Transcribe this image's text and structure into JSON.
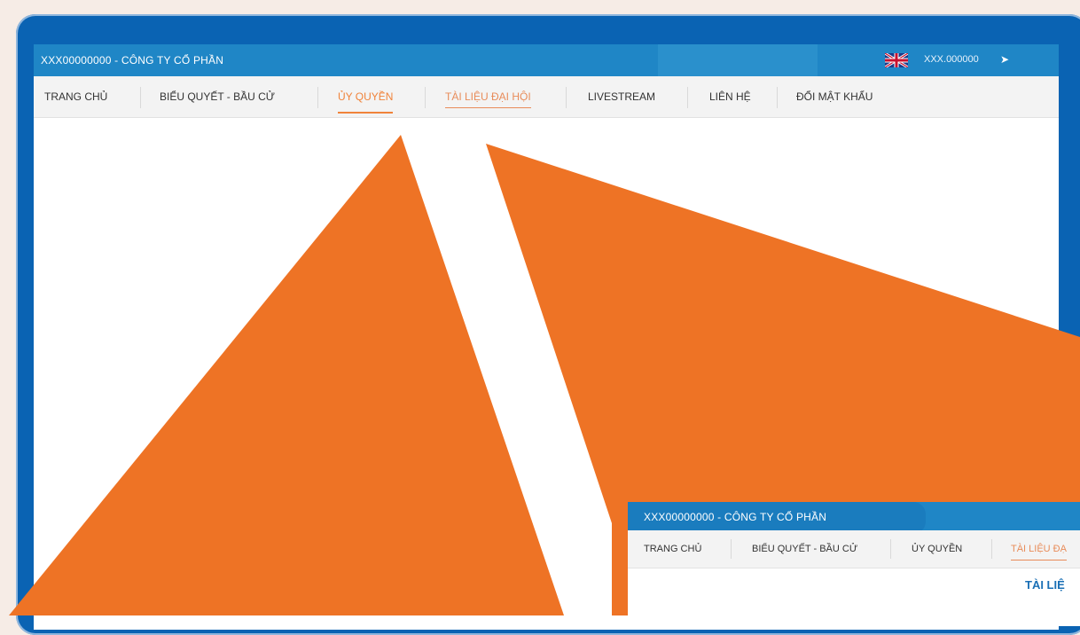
{
  "main_window": {
    "company": "XXX00000000 - CÔNG TY CỔ PHẦN",
    "account": "XXX.000000",
    "language_icon": "uk-flag-icon",
    "logout_icon": "logout-icon",
    "nav": [
      {
        "label": "TRANG CHỦ"
      },
      {
        "label": "BIỂU QUYẾT - BẦU CỬ"
      },
      {
        "label": "ỦY QUYỀN"
      },
      {
        "label": "TÀI LIỆU ĐẠI HỘI"
      },
      {
        "label": "LIVESTREAM"
      },
      {
        "label": "LIÊN HỆ"
      },
      {
        "label": "ĐỔI MẬT KHẨU"
      }
    ]
  },
  "preview_window": {
    "company": "XXX00000000 - CÔNG TY CỔ PHẦN",
    "nav": [
      {
        "label": "TRANG CHỦ"
      },
      {
        "label": "BIỂU QUYẾT - BẦU CỬ"
      },
      {
        "label": "ỦY QUYỀN"
      },
      {
        "label": "TÀI LIỆU ĐẠ"
      }
    ],
    "heading": "TÀI LIỆ"
  },
  "colors": {
    "frame": "#0a63b3",
    "topbar": "#1f86c6",
    "accent": "#f0833a",
    "callout": "#ee7325"
  }
}
